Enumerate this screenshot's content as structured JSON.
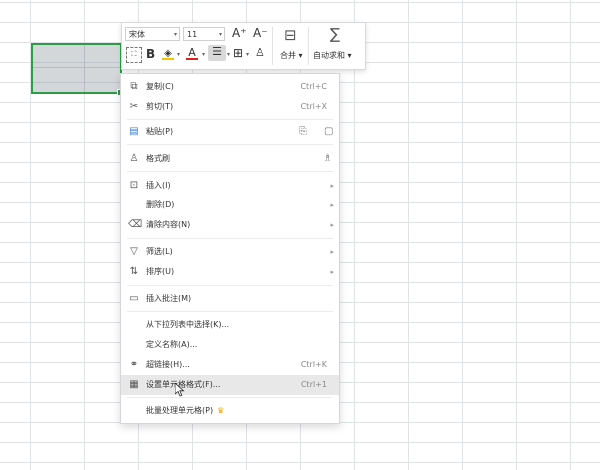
{
  "toolbar": {
    "font_name": "宋体",
    "font_size": "11",
    "grow_font": "A⁺",
    "shrink_font": "A⁻",
    "bold": "B",
    "font_color_letter": "A",
    "merge_label": "合并",
    "autosum_label": "自动求和"
  },
  "context_menu": {
    "copy": {
      "label": "复制(C)",
      "shortcut": "Ctrl+C"
    },
    "cut": {
      "label": "剪切(T)",
      "shortcut": "Ctrl+X"
    },
    "paste": {
      "label": "粘贴(P)"
    },
    "format_painter": {
      "label": "格式刷"
    },
    "insert": {
      "label": "插入(I)"
    },
    "delete": {
      "label": "删除(D)"
    },
    "clear": {
      "label": "清除内容(N)"
    },
    "filter": {
      "label": "筛选(L)"
    },
    "sort": {
      "label": "排序(U)"
    },
    "insert_comment": {
      "label": "插入批注(M)"
    },
    "pick_from_list": {
      "label": "从下拉列表中选择(K)..."
    },
    "define_name": {
      "label": "定义名称(A)..."
    },
    "hyperlink": {
      "label": "超链接(H)...",
      "shortcut": "Ctrl+K"
    },
    "format_cells": {
      "label": "设置单元格格式(F)...",
      "shortcut": "Ctrl+1"
    },
    "batch_process": {
      "label": "批量处理单元格(P)"
    }
  },
  "colors": {
    "selection_border": "#2e9b47",
    "font_color_red": "#e02020",
    "fill_yellow": "#f5c400",
    "crown_gold": "#f0a400"
  }
}
